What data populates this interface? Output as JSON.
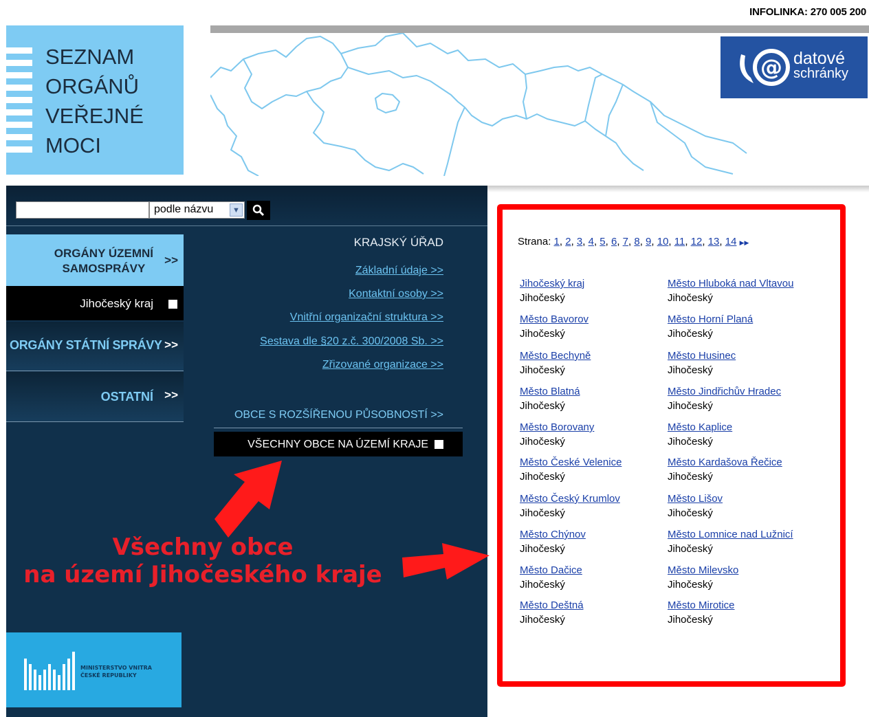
{
  "header": {
    "infolinka": "INFOLINKA: 270 005 200",
    "logo_lines": [
      "SEZNAM",
      "ORGÁNŮ",
      "VEŘEJNÉ",
      "MOCI"
    ],
    "ds_logo_line1": "datové",
    "ds_logo_line2": "schránky",
    "ds_logo_icon": "at-sign-icon"
  },
  "search": {
    "value": "",
    "select_value": "podle názvu",
    "button_icon": "search-icon"
  },
  "left_menu": {
    "item1_line1": "ORGÁNY ÚZEMNÍ",
    "item1_line2": "SAMOSPRÁVY",
    "item1_arrow": ">>",
    "item2": "Jihočeský kraj",
    "item3": "ORGÁNY STÁTNÍ SPRÁVY",
    "item3_arrow": ">>",
    "item4": "OSTATNÍ",
    "item4_arrow": ">>"
  },
  "middle": {
    "title": "KRAJSKÝ ÚŘAD",
    "links": [
      "Základní údaje  >>",
      "Kontaktní osoby  >>",
      "Vnitřní organizační struktura  >>",
      "Sestava dle §20 z.č. 300/2008 Sb.  >>",
      "Zřizované organizace  >>"
    ],
    "obce_rozsirene": "OBCE S ROZŠÍŘENOU PŮSOBNOSTÍ  >>",
    "vsechny_obce": "VŠECHNY OBCE NA ÚZEMÍ KRAJE"
  },
  "annotation": {
    "line1": "Všechny obce",
    "line2": "na území Jihočeského kraje",
    "color": "#e8202a"
  },
  "footer_logo": {
    "line1": "MINISTERSTVO VNITRA",
    "line2": "ČESKÉ REPUBLIKY"
  },
  "results": {
    "strana_label": "Strana:",
    "pages": [
      "1",
      "2",
      "3",
      "4",
      "5",
      "6",
      "7",
      "8",
      "9",
      "10",
      "11",
      "12",
      "13",
      "14"
    ],
    "next_icon": "next-page-icon",
    "left_column": [
      {
        "name": "Jihočeský kraj",
        "region": "Jihočeský"
      },
      {
        "name": "Město Bavorov",
        "region": "Jihočeský"
      },
      {
        "name": "Město Bechyně",
        "region": "Jihočeský"
      },
      {
        "name": "Město Blatná",
        "region": "Jihočeský"
      },
      {
        "name": "Město Borovany",
        "region": "Jihočeský"
      },
      {
        "name": "Město České Velenice",
        "region": "Jihočeský"
      },
      {
        "name": "Město Český Krumlov",
        "region": "Jihočeský"
      },
      {
        "name": "Město Chýnov",
        "region": "Jihočeský"
      },
      {
        "name": "Město Dačice",
        "region": "Jihočeský"
      },
      {
        "name": "Město Deštná",
        "region": "Jihočeský"
      }
    ],
    "right_column": [
      {
        "name": "Město Hluboká nad Vltavou",
        "region": "Jihočeský"
      },
      {
        "name": "Město Horní Planá",
        "region": "Jihočeský"
      },
      {
        "name": "Město Husinec",
        "region": "Jihočeský"
      },
      {
        "name": "Město Jindřichův Hradec",
        "region": "Jihočeský"
      },
      {
        "name": "Město Kaplice",
        "region": "Jihočeský"
      },
      {
        "name": "Město Kardašova Řečice",
        "region": "Jihočeský"
      },
      {
        "name": "Město Lišov",
        "region": "Jihočeský"
      },
      {
        "name": "Město Lomnice nad Lužnicí",
        "region": "Jihočeský"
      },
      {
        "name": "Město Milevsko",
        "region": "Jihočeský"
      },
      {
        "name": "Město Mirotice",
        "region": "Jihočeský"
      }
    ]
  }
}
